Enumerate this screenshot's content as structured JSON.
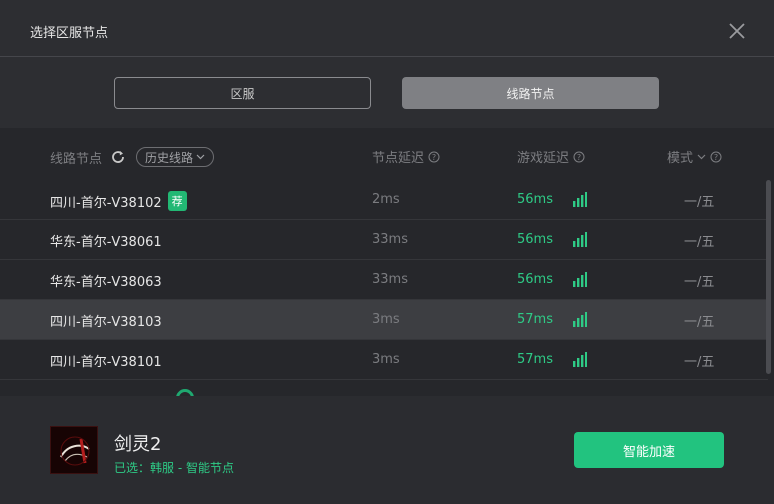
{
  "dialog": {
    "title": "选择区服节点"
  },
  "tabs": {
    "region": "区服",
    "node": "线路节点"
  },
  "header": {
    "node_col": "线路节点",
    "history": "历史线路",
    "latency_col": "节点延迟",
    "game_latency_col": "游戏延迟",
    "mode_col": "模式"
  },
  "rows": [
    {
      "name": "四川-首尔-V38102",
      "badge": "荐",
      "latency": "2ms",
      "game_latency": "56ms",
      "mode": "一/五"
    },
    {
      "name": "华东-首尔-V38061",
      "latency": "33ms",
      "game_latency": "56ms",
      "mode": "一/五"
    },
    {
      "name": "华东-首尔-V38063",
      "latency": "33ms",
      "game_latency": "56ms",
      "mode": "一/五"
    },
    {
      "name": "四川-首尔-V38103",
      "latency": "3ms",
      "game_latency": "57ms",
      "mode": "一/五"
    },
    {
      "name": "四川-首尔-V38101",
      "latency": "3ms",
      "game_latency": "57ms",
      "mode": "一/五"
    }
  ],
  "footer": {
    "game_name": "剑灵2",
    "selected": "已选：韩服 - 智能节点",
    "accelerate_button": "智能加速"
  },
  "colors": {
    "accent_green": "#22c37f",
    "background": "#2d2e32",
    "list_background": "#26272b"
  }
}
